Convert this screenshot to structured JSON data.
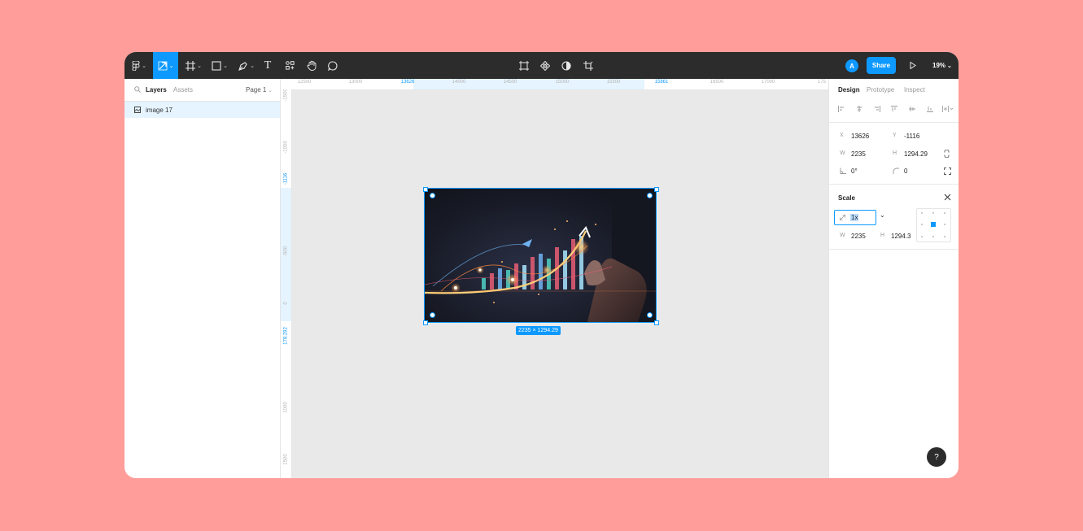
{
  "toolbar": {
    "tools": [
      {
        "name": "main-menu",
        "icon": "figma-logo-icon"
      },
      {
        "name": "move-tool",
        "icon": "move-icon",
        "active": true
      },
      {
        "name": "frame-tool",
        "icon": "frame-icon"
      },
      {
        "name": "shape-tool",
        "icon": "rectangle-icon"
      },
      {
        "name": "pen-tool",
        "icon": "pen-icon"
      },
      {
        "name": "text-tool",
        "icon": "text-icon",
        "label": "T"
      },
      {
        "name": "resources-tool",
        "icon": "resources-icon"
      },
      {
        "name": "hand-tool",
        "icon": "hand-icon"
      },
      {
        "name": "comment-tool",
        "icon": "comment-icon"
      }
    ],
    "center_tools": [
      "component-icon",
      "mask-icon",
      "contrast-icon",
      "crop-icon"
    ],
    "avatar_initial": "A",
    "share_label": "Share",
    "zoom_label": "19%"
  },
  "left_panel": {
    "tab_layers": "Layers",
    "tab_assets": "Assets",
    "page_label": "Page 1",
    "layers": [
      {
        "name": "image 17"
      }
    ]
  },
  "ruler_top": {
    "labels": [
      "12500",
      "13000",
      "13626",
      "14000",
      "14500",
      "15000",
      "15500",
      "15861",
      "16500",
      "17000",
      "175"
    ],
    "selected": [
      "13626",
      "15861"
    ]
  },
  "ruler_left": {
    "labels": [
      "-1500",
      "-1000",
      "-1116",
      "-500",
      "0",
      "178.292",
      "1000",
      "1500"
    ],
    "selected": [
      "-1116",
      "178.292"
    ]
  },
  "canvas": {
    "image_label": "2235 × 1294.29"
  },
  "right_panel": {
    "tabs": [
      "Design",
      "Prototype",
      "Inspect"
    ],
    "x_label": "X",
    "x_value": "13626",
    "y_label": "Y",
    "y_value": "-1116",
    "w_label": "W",
    "w_value": "2235",
    "h_label": "H",
    "h_value": "1294.29",
    "rotation_value": "0°",
    "radius_value": "0",
    "scale_title": "Scale",
    "scale_value": "1x",
    "scale_w_label": "W",
    "scale_w_value": "2235",
    "scale_h_label": "H",
    "scale_h_value": "1294.3"
  },
  "help_label": "?",
  "colors": {
    "background": "#ff9d9a",
    "toolbar": "#2c2c2c",
    "accent": "#0d99ff",
    "canvas": "#e9e9e9",
    "layer_selected": "#e5f4ff"
  }
}
